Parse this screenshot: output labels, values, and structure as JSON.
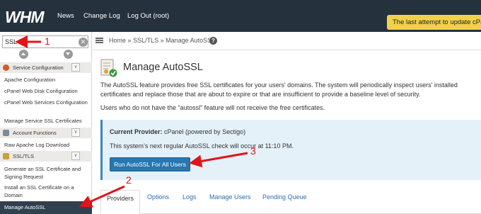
{
  "header": {
    "logo": "WHM",
    "nav": [
      "News",
      "Change Log",
      "Log Out (root)"
    ],
    "notice": "The last attempt to update cPanel"
  },
  "sidebar": {
    "search_value": "SSL",
    "clear_glyph": "✕",
    "sections": [
      {
        "title": "Service Configuration",
        "icon": "service-config-icon",
        "items": [
          "Apache Configuration",
          "cPanel Web Disk Configuration",
          "cPanel Web Services Configuration",
          "Manage Service SSL Certificates"
        ]
      },
      {
        "title": "Account Functions",
        "icon": "user-icon",
        "items": [
          "Raw Apache Log Download"
        ]
      },
      {
        "title": "SSL/TLS",
        "icon": "ssl-icon",
        "items": [
          "Generate an SSL Certificate and Signing Request",
          "Install an SSL Certificate on a Domain",
          "Manage AutoSSL"
        ]
      }
    ],
    "selected": "Manage AutoSSL"
  },
  "breadcrumb": {
    "items": [
      "Home",
      "SSL/TLS",
      "Manage AutoSSL"
    ],
    "separator": "»",
    "help": "?"
  },
  "page": {
    "title": "Manage AutoSSL",
    "description": "The AutoSSL feature provides free SSL certificates for your users' domains. The system will periodically inspect users' installed certificates and replace those that are about to expire or that are insufficient to provide a baseline level of security.",
    "note": "Users who do not have the “autossl” feature will not receive the free certificates."
  },
  "provider": {
    "label": "Current Provider:",
    "value": "cPanel (powered by Sectigo)",
    "next_check": "This system’s next regular AutoSSL check will occur at 11:10 PM.",
    "button": "Run AutoSSL For All Users"
  },
  "tabs": [
    "Providers",
    "Options",
    "Logs",
    "Manage Users",
    "Pending Queue"
  ],
  "annotations": [
    "1",
    "2",
    "3"
  ],
  "colors": {
    "topbar": "#25313d",
    "notice": "#f1d14a",
    "selected_item": "#31404f",
    "button": "#2777b0",
    "annotation": "#e0141a",
    "link": "#2a6db0"
  }
}
